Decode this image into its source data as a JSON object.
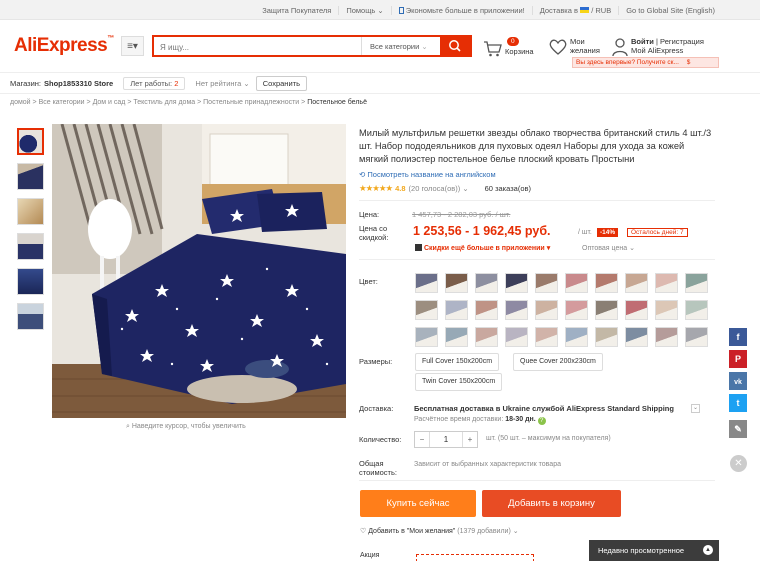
{
  "topbar": {
    "links": [
      "Защита Покупателя",
      "Помощь",
      "Экономьте больше в приложении!",
      "Доставка в",
      "/  RUB",
      "Go to Global Site (English)"
    ]
  },
  "header": {
    "logo": "AliExpress",
    "search_placeholder": "Я ищу...",
    "category_select": "Все категории",
    "cart_count": "0",
    "cart_label": "Корзина",
    "wishlist_label_1": "Мои",
    "wishlist_label_2": "желания",
    "login": "Войти",
    "register": "Регистрация",
    "my_aliexpress": "Мой AliExpress",
    "first_time": "Вы здесь впервые? Получите ск...",
    "first_time_badge": "$"
  },
  "store": {
    "label": "Магазин:",
    "name": "Shop1853310 Store",
    "years_label": "Лет работы:",
    "years": "2",
    "rating": "Нет рейтинга",
    "save": "Сохранить"
  },
  "breadcrumb": [
    "домой",
    "Все категории",
    "Дом и сад",
    "Текстиль для дома",
    "Постельные принадлежности",
    "Постельное бельё"
  ],
  "product": {
    "title": "Милый мультфильм решетки звезды облако творчества британский стиль 4 шт./3 шт. Набор пододеяльников для пуховых одеял Наборы для ухода за кожей мягкий полиэстер постельное белье плоский кровать Простыни",
    "english_link": "Посмотреть название на английском",
    "rating_score": "4.8",
    "votes": "(20 голоса(ов))",
    "orders": "60 заказа(ов)",
    "zoom_hint": "Наведите курсор, чтобы увеличить"
  },
  "price": {
    "label": "Цена:",
    "old": "1 457,73 - 2 282,03 руб. / шт.",
    "sale_label_1": "Цена со",
    "sale_label_2": "скидкой:",
    "new": "1 253,56 - 1 962,45 руб.",
    "per_unit": "/ шт.",
    "discount": "-14%",
    "days_left": "Осталось дней: 7",
    "app_discount": "Скидки ещё больше в приложении",
    "wholesale": "Оптовая цена"
  },
  "options": {
    "color_label": "Цвет:",
    "swatch_colors": [
      "#6b6f8a",
      "#7a5d4a",
      "#8d8fa0",
      "#3d3f5a",
      "#9a7b6b",
      "#c98a8c",
      "#b47a6d",
      "#c7a793",
      "#ddb9b0",
      "#8aa39c",
      "#9c8e80",
      "#aeb4c6",
      "#bf9386",
      "#8e8aa3",
      "#cdb2a1",
      "#d49b9d",
      "#8a7f74",
      "#c06d73",
      "#dcc7b6",
      "#b7c6bd",
      "#a8b2bd",
      "#97a9b6",
      "#c9a89f",
      "#b9b4c2",
      "#d1b3a9",
      "#9fb0c4",
      "#c3b8a6",
      "#7d8da1",
      "#b59c9a",
      "#a6a7ad"
    ],
    "size_label": "Размеры:",
    "sizes": [
      "Full Cover 150x200cm",
      "Quee Cover 200x230cm",
      "Twin Cover 150x200cm"
    ]
  },
  "shipping": {
    "label": "Доставка:",
    "text": "Бесплатная доставка в Ukraine службой AliExpress Standard Shipping",
    "time_label": "Расчётное время доставки:",
    "time": "18-30 дн."
  },
  "quantity": {
    "label": "Количество:",
    "value": "1",
    "note": "шт. (50 шт. – максимум на покупателя)"
  },
  "total": {
    "label_1": "Общая",
    "label_2": "стоимость:",
    "note": "Зависит от выбранных характеристик товара"
  },
  "actions": {
    "buy_now": "Купить сейчас",
    "add_to_cart": "Добавить в корзину",
    "add_wishlist": "Добавить в \"Мои желания\"",
    "wishlist_count": "(1379 добавили)",
    "promo_label": "Акция"
  },
  "recently_viewed": "Недавно просмотренное",
  "colors": {
    "brand": "#e62e04",
    "buy_now": "#ff7e1a",
    "add_to_cart": "#e84c24",
    "link": "#2e6cb5",
    "star": "#f2a81d"
  }
}
